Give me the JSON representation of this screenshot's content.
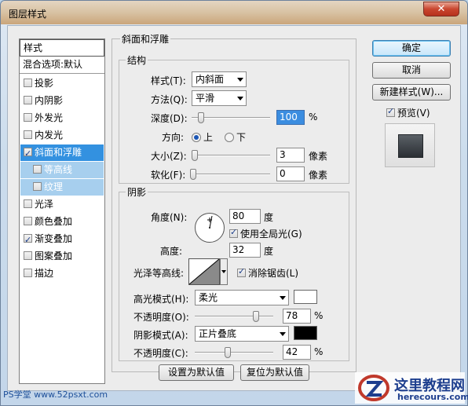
{
  "window": {
    "title": "图层样式",
    "close": "✕"
  },
  "sidebar": {
    "header": "样式",
    "blend": "混合选项:默认",
    "items": [
      {
        "label": "投影",
        "checked": false
      },
      {
        "label": "内阴影",
        "checked": false
      },
      {
        "label": "外发光",
        "checked": false
      },
      {
        "label": "内发光",
        "checked": false
      },
      {
        "label": "斜面和浮雕",
        "checked": true,
        "selected": true
      },
      {
        "label": "等高线",
        "checked": false,
        "sub": true
      },
      {
        "label": "纹理",
        "checked": false,
        "sub": true
      },
      {
        "label": "光泽",
        "checked": false
      },
      {
        "label": "颜色叠加",
        "checked": false
      },
      {
        "label": "渐变叠加",
        "checked": true
      },
      {
        "label": "图案叠加",
        "checked": false
      },
      {
        "label": "描边",
        "checked": false
      }
    ]
  },
  "bevel": {
    "section_title": "斜面和浮雕",
    "structure": {
      "title": "结构",
      "style_label": "样式(T):",
      "style_value": "内斜面",
      "method_label": "方法(Q):",
      "method_value": "平滑",
      "depth_label": "深度(D):",
      "depth_value": "100",
      "depth_unit": "%",
      "depth_level": 0.1,
      "direction_label": "方向:",
      "direction_up": "上",
      "direction_down": "下",
      "direction_selected": "上",
      "size_label": "大小(Z):",
      "size_value": "3",
      "size_unit": "像素",
      "size_level": 0.02,
      "soften_label": "软化(F):",
      "soften_value": "0",
      "soften_unit": "像素",
      "soften_level": 0.0
    },
    "shading": {
      "title": "阴影",
      "angle_label": "角度(N):",
      "angle_value": "80",
      "angle_unit": "度",
      "global_light_label": "使用全局光(G)",
      "global_light_checked": true,
      "altitude_label": "高度:",
      "altitude_value": "32",
      "altitude_unit": "度",
      "gloss_label": "光泽等高线:",
      "antialias_label": "消除锯齿(L)",
      "antialias_checked": true,
      "highlight_mode_label": "高光模式(H):",
      "highlight_mode_value": "柔光",
      "highlight_color": "#ffffff",
      "highlight_opacity_label": "不透明度(O):",
      "highlight_opacity_value": "78",
      "highlight_opacity_unit": "%",
      "highlight_opacity_level": 0.78,
      "shadow_mode_label": "阴影模式(A):",
      "shadow_mode_value": "正片叠底",
      "shadow_color": "#000000",
      "shadow_opacity_label": "不透明度(C):",
      "shadow_opacity_value": "42",
      "shadow_opacity_unit": "%",
      "shadow_opacity_level": 0.42
    },
    "set_default": "设置为默认值",
    "reset_default": "复位为默认值"
  },
  "buttons": {
    "ok": "确定",
    "cancel": "取消",
    "new_style": "新建样式(W)...",
    "preview_label": "预览(V)",
    "preview_checked": true
  },
  "watermark": {
    "left": "PS学堂 www.52psxt.com",
    "right_cn": "这里教程网",
    "right_en": "herecours.com"
  }
}
